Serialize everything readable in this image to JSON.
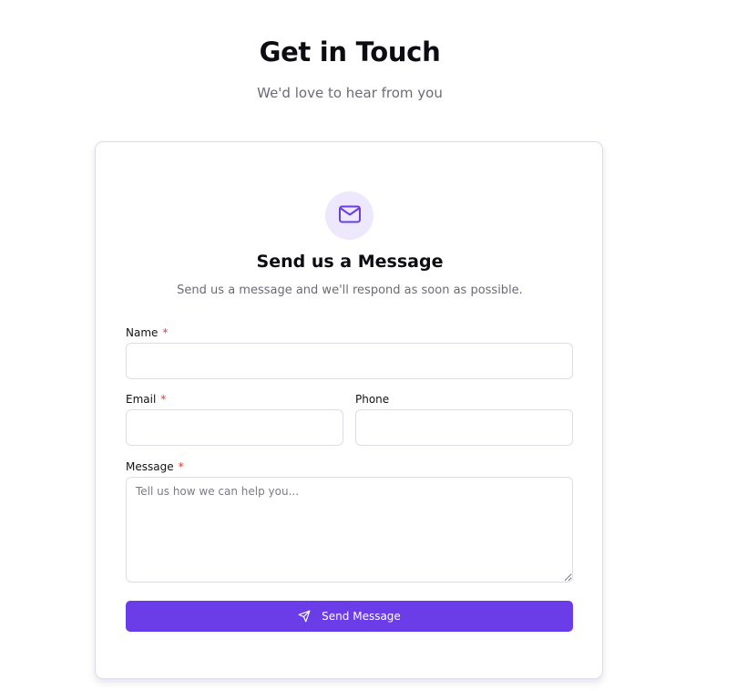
{
  "header": {
    "title": "Get in Touch",
    "subtitle": "We'd love to hear from you"
  },
  "card": {
    "icon": "mail-icon",
    "title": "Send us a Message",
    "description": "Send us a message and we'll respond as soon as possible."
  },
  "form": {
    "name": {
      "label": "Name",
      "required_mark": "*",
      "value": ""
    },
    "email": {
      "label": "Email",
      "required_mark": "*",
      "value": ""
    },
    "phone": {
      "label": "Phone",
      "value": ""
    },
    "message": {
      "label": "Message",
      "required_mark": "*",
      "placeholder": "Tell us how we can help you...",
      "value": ""
    },
    "submit": {
      "label": "Send Message",
      "icon": "send-icon"
    }
  },
  "colors": {
    "accent": "#6a3de8",
    "icon_bg": "#ede8fc",
    "required": "#e53935"
  }
}
